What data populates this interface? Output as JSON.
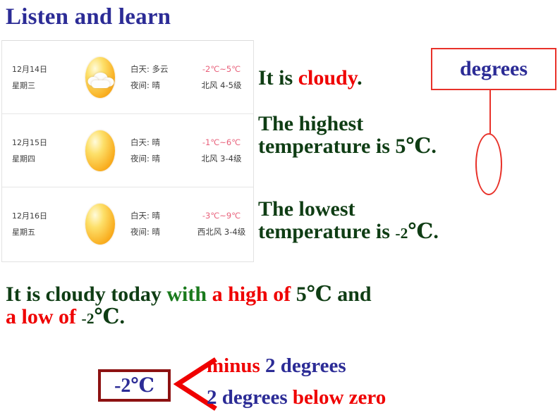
{
  "title": "Listen and learn",
  "weather_table": {
    "rows": [
      {
        "date": "12月14日",
        "weekday": "星期三",
        "icon": "sun-behind-cloud-icon",
        "day_label": "白天: 多云",
        "night_label": "夜间: 晴",
        "temperature": "-2℃~5℃",
        "wind": "北风 4-5级"
      },
      {
        "date": "12月15日",
        "weekday": "星期四",
        "icon": "sun-icon",
        "day_label": "白天: 晴",
        "night_label": "夜间: 晴",
        "temperature": "-1℃~6℃",
        "wind": "北风 3-4级"
      },
      {
        "date": "12月16日",
        "weekday": "星期五",
        "icon": "sun-icon",
        "day_label": "白天: 晴",
        "night_label": "夜间: 晴",
        "temperature": "-3℃~9℃",
        "wind": "西北风 3-4级"
      }
    ]
  },
  "sentences": {
    "cloudy": {
      "part1": "It is ",
      "part2": "cloudy",
      "part3": "."
    },
    "highest": {
      "line1": "The highest",
      "line2_pre": "temperature is 5",
      "line2_unit": "℃",
      "line2_post": "."
    },
    "lowest": {
      "line1": "The lowest",
      "line2_pre": "temperature is ",
      "line2_neg": "-2",
      "line2_unit": "℃",
      "line2_post": "."
    },
    "summary": {
      "p1": "It is cloudy today ",
      "p2": "with ",
      "p3": "a high of ",
      "p4": "5℃ and",
      "p5": "a low of ",
      "p6": "-2",
      "p7": "℃",
      "p8": "."
    }
  },
  "callouts": {
    "degrees_label": "degrees",
    "neg_value": "-2℃",
    "explain_1_red": "minus ",
    "explain_1_blue": "2 degrees",
    "explain_2_blue": "2 degrees ",
    "explain_2_red": "below zero"
  },
  "colors": {
    "title_blue": "#2c2c96",
    "dark_green": "#0f3d14",
    "bright_green": "#1a7a1d",
    "red": "#ef0000",
    "callout_red_border": "#e8322a",
    "neg_box_border": "#8d1212",
    "temp_pink": "#e8607a"
  }
}
